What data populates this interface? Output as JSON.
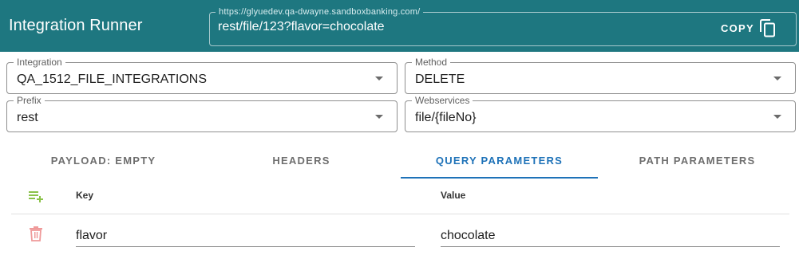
{
  "app": {
    "title": "Integration Runner"
  },
  "url_field": {
    "label": "https://glyuedev.qa-dwayne.sandboxbanking.com/",
    "value": "rest/file/123?flavor=chocolate",
    "copy_label": "COPY"
  },
  "form": {
    "integration": {
      "label": "Integration",
      "value": "QA_1512_FILE_INTEGRATIONS"
    },
    "method": {
      "label": "Method",
      "value": "DELETE"
    },
    "prefix": {
      "label": "Prefix",
      "value": "rest"
    },
    "webservices": {
      "label": "Webservices",
      "value": "file/{fileNo}"
    }
  },
  "tabs": [
    {
      "label": "PAYLOAD: EMPTY",
      "active": false
    },
    {
      "label": "HEADERS",
      "active": false
    },
    {
      "label": "QUERY PARAMETERS",
      "active": true
    },
    {
      "label": "PATH PARAMETERS",
      "active": false
    }
  ],
  "params_table": {
    "columns": {
      "key": "Key",
      "value": "Value"
    },
    "rows": [
      {
        "key": "flavor",
        "value": "chocolate"
      }
    ]
  },
  "colors": {
    "header_bg": "#1e7780",
    "active_tab": "#1e72b8",
    "add_icon": "#8bc34a",
    "delete_icon": "#ef9a9a"
  },
  "icons": {
    "copy": "copy-icon",
    "add_row": "playlist-add-icon",
    "delete_row": "trash-icon",
    "dropdown": "caret-down-icon"
  }
}
